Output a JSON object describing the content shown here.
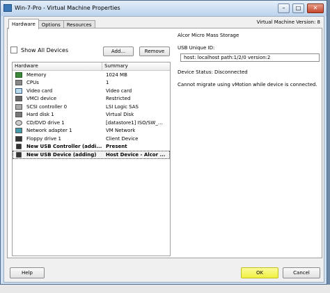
{
  "window": {
    "title": "Win-7-Pro - Virtual Machine Properties",
    "controls": [
      "–",
      "□",
      "✕"
    ]
  },
  "tabs": [
    {
      "label": "Hardware",
      "active": true
    },
    {
      "label": "Options",
      "active": false
    },
    {
      "label": "Resources",
      "active": false
    }
  ],
  "vm_version": "Virtual Machine Version: 8",
  "toolbar": {
    "show_all_devices": "Show All Devices",
    "show_all_checked": false,
    "add_label": "Add...",
    "remove_label": "Remove"
  },
  "table": {
    "columns": [
      "Hardware",
      "Summary"
    ],
    "rows": [
      {
        "icon": "memory-icon",
        "name": "Memory",
        "summary": "1024 MB",
        "bold": false,
        "selected": false
      },
      {
        "icon": "cpu-icon",
        "name": "CPUs",
        "summary": "1",
        "bold": false,
        "selected": false
      },
      {
        "icon": "video-card-icon",
        "name": "Video card",
        "summary": "Video card",
        "bold": false,
        "selected": false
      },
      {
        "icon": "vmci-icon",
        "name": "VMCI device",
        "summary": "Restricted",
        "bold": false,
        "selected": false
      },
      {
        "icon": "scsi-controller-icon",
        "name": "SCSI controller 0",
        "summary": "LSI Logic SAS",
        "bold": false,
        "selected": false
      },
      {
        "icon": "hard-disk-icon",
        "name": "Hard disk 1",
        "summary": "Virtual Disk",
        "bold": false,
        "selected": false
      },
      {
        "icon": "cd-dvd-icon",
        "name": "CD/DVD drive 1",
        "summary": "[datastore1] ISO/SW_...",
        "bold": false,
        "selected": false
      },
      {
        "icon": "network-adapter-icon",
        "name": "Network adapter 1",
        "summary": "VM Network",
        "bold": false,
        "selected": false
      },
      {
        "icon": "floppy-icon",
        "name": "Floppy drive 1",
        "summary": "Client Device",
        "bold": false,
        "selected": false
      },
      {
        "icon": "usb-icon",
        "name": "New USB Controller (addi...",
        "summary": "Present",
        "bold": true,
        "selected": false
      },
      {
        "icon": "usb-icon",
        "name": "New USB Device (adding)",
        "summary": "Host Device - Alcor ...",
        "bold": true,
        "selected": true
      }
    ]
  },
  "details": {
    "device_title": "Alcor Micro Mass Storage",
    "usb_id_label": "USB Unique ID:",
    "usb_id_value": "host: localhost path:1/2/0 version:2",
    "status": "Device Status: Disconnected",
    "vmotion_note": "Cannot migrate using vMotion while device is connected."
  },
  "footer": {
    "help_label": "Help",
    "ok_label": "OK",
    "cancel_label": "Cancel"
  },
  "colors": {
    "ok_highlight": "#f0f040",
    "title_gradient_top": "#e4eef9",
    "title_gradient_bottom": "#bcd3ec"
  }
}
